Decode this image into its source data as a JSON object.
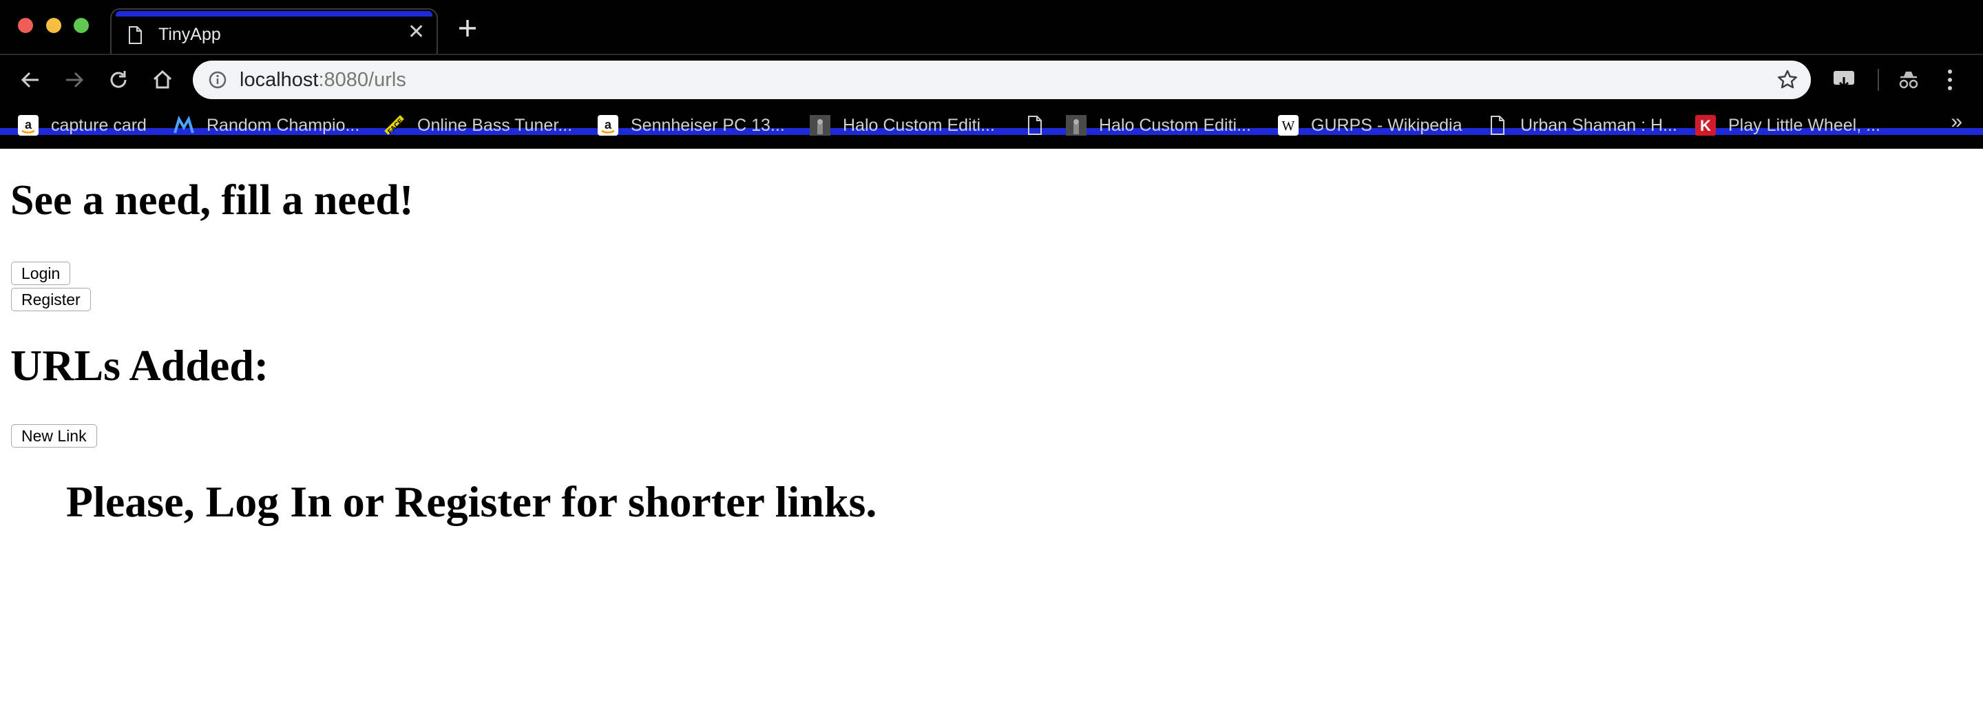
{
  "browser": {
    "tab_title": "TinyApp",
    "url_host": "localhost",
    "url_rest": ":8080/urls",
    "bookmarks": [
      {
        "label": "capture card",
        "icon": "amazon-icon"
      },
      {
        "label": "Random Champio...",
        "icon": "m-logo-icon"
      },
      {
        "label": "Online Bass Tuner...",
        "icon": "tuner-icon"
      },
      {
        "label": "Sennheiser PC 13...",
        "icon": "amazon-icon"
      },
      {
        "label": "Halo Custom Editi...",
        "icon": "halo-icon"
      },
      {
        "label": "",
        "icon": "page-icon"
      },
      {
        "label": "Halo Custom Editi...",
        "icon": "halo-icon"
      },
      {
        "label": "GURPS - Wikipedia",
        "icon": "wikipedia-icon"
      },
      {
        "label": "Urban Shaman : H...",
        "icon": "page-icon"
      },
      {
        "label": "Play Little Wheel, ...",
        "icon": "k-logo-icon"
      }
    ],
    "overflow_glyph": "»"
  },
  "page": {
    "heading": "See a need, fill a need!",
    "login_label": "Login",
    "register_label": "Register",
    "urls_heading": "URLs Added:",
    "new_link_label": "New Link",
    "notice": "Please, Log In or Register for shorter links."
  },
  "colors": {
    "chrome_bg": "#000000",
    "accent_blue": "#1e2ad8",
    "omnibox_bg": "#f1f3f4"
  }
}
